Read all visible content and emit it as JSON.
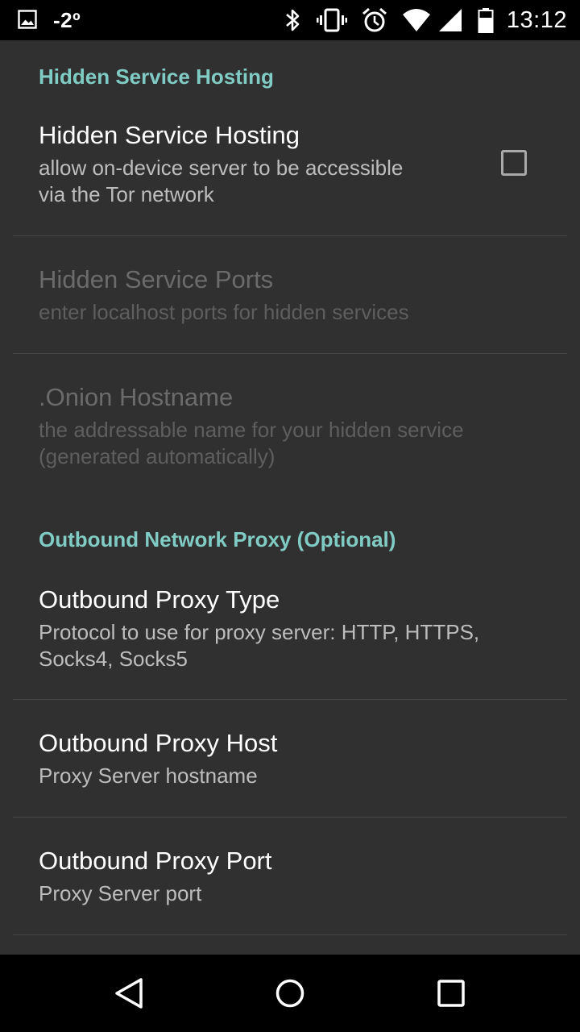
{
  "status_bar": {
    "temperature": "-2º",
    "time": "13:12",
    "icons": [
      "image-notification-icon",
      "bluetooth-icon",
      "vibrate-icon",
      "alarm-icon",
      "wifi-icon",
      "cell-signal-icon",
      "battery-icon"
    ]
  },
  "colors": {
    "accent": "#80cbc4",
    "background": "#303030",
    "title": "#ffffff",
    "summary": "#bdbdbd",
    "disabled": "#6b6b6b"
  },
  "hidden_service": {
    "category": "Hidden Service Hosting",
    "hosting": {
      "title": "Hidden Service Hosting",
      "summary": "allow on-device server to be accessible\nvia the Tor network",
      "checked": false
    },
    "ports": {
      "title": "Hidden Service Ports",
      "summary": "enter localhost ports for hidden services",
      "enabled": false
    },
    "hostname": {
      "title": ".Onion Hostname",
      "summary": "the addressable name for your hidden service\n(generated automatically)",
      "enabled": false
    }
  },
  "proxy": {
    "category": "Outbound Network Proxy (Optional)",
    "type": {
      "title": "Outbound Proxy Type",
      "summary": "Protocol to use for proxy server: HTTP, HTTPS,\nSocks4, Socks5"
    },
    "host": {
      "title": "Outbound Proxy Host",
      "summary": "Proxy Server hostname"
    },
    "port": {
      "title": "Outbound Proxy Port",
      "summary": "Proxy Server port"
    }
  },
  "nav_bar": {
    "buttons": [
      "back-icon",
      "home-icon",
      "recents-icon"
    ]
  }
}
